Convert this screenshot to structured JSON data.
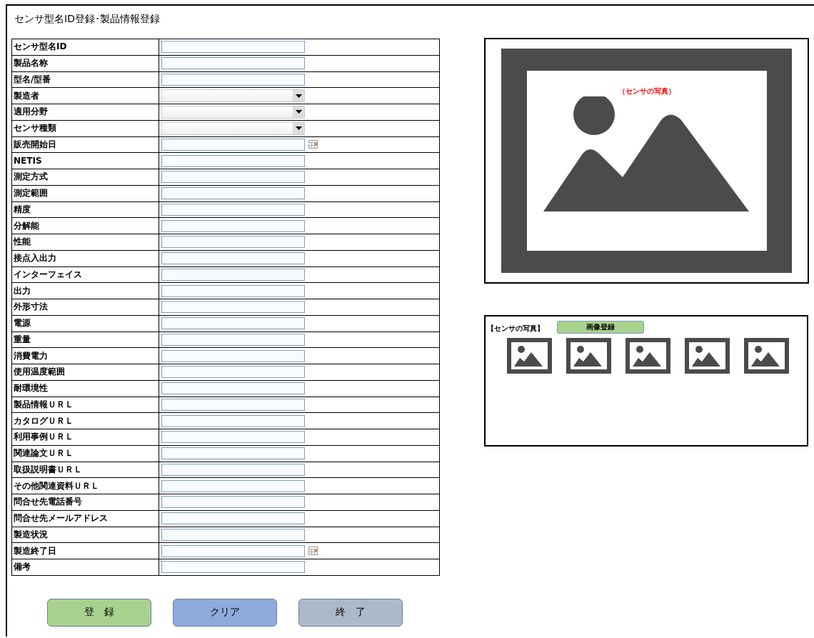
{
  "window": {
    "title": "センサ型名ID登録･製品情報登録"
  },
  "fields": [
    {
      "label": "センサ型名ID",
      "kind": "text"
    },
    {
      "label": "製品名称",
      "kind": "text"
    },
    {
      "label": "型名/型番",
      "kind": "text"
    },
    {
      "label": "製造者",
      "kind": "select"
    },
    {
      "label": "適用分野",
      "kind": "select"
    },
    {
      "label": "センサ種類",
      "kind": "select"
    },
    {
      "label": "販売開始日",
      "kind": "date"
    },
    {
      "label": "NETIS",
      "kind": "text"
    },
    {
      "label": "測定方式",
      "kind": "text"
    },
    {
      "label": "測定範囲",
      "kind": "text"
    },
    {
      "label": "精度",
      "kind": "text"
    },
    {
      "label": "分解能",
      "kind": "text"
    },
    {
      "label": "性能",
      "kind": "text"
    },
    {
      "label": "接点入出力",
      "kind": "text"
    },
    {
      "label": "インターフェイス",
      "kind": "text"
    },
    {
      "label": "出力",
      "kind": "text"
    },
    {
      "label": "外形寸法",
      "kind": "text"
    },
    {
      "label": "電源",
      "kind": "text"
    },
    {
      "label": "重量",
      "kind": "text"
    },
    {
      "label": "消費電力",
      "kind": "text"
    },
    {
      "label": "使用温度範囲",
      "kind": "text"
    },
    {
      "label": "耐環境性",
      "kind": "text"
    },
    {
      "label": "製品情報ＵＲＬ",
      "kind": "text"
    },
    {
      "label": "カタログＵＲＬ",
      "kind": "text"
    },
    {
      "label": "利用事例ＵＲＬ",
      "kind": "text"
    },
    {
      "label": "関連論文ＵＲＬ",
      "kind": "text"
    },
    {
      "label": "取扱説明書ＵＲＬ",
      "kind": "text"
    },
    {
      "label": "その他関連資料ＵＲＬ",
      "kind": "text"
    },
    {
      "label": "問合せ先電話番号",
      "kind": "text"
    },
    {
      "label": "問合せ先メールアドレス",
      "kind": "text"
    },
    {
      "label": "製造状況",
      "kind": "text"
    },
    {
      "label": "製造終了日",
      "kind": "date"
    },
    {
      "label": "備考",
      "kind": "text"
    }
  ],
  "photo": {
    "caption": "（センサの写真）"
  },
  "gallery": {
    "label": "【センサの写真】",
    "button": "画像登録",
    "thumbnails": [
      {
        "kind": "image"
      },
      {
        "kind": "image"
      },
      {
        "kind": "image"
      },
      {
        "kind": "image"
      },
      {
        "kind": "image"
      }
    ]
  },
  "buttons": [
    {
      "label": "登　録",
      "kind": "register"
    },
    {
      "label": "クリア",
      "kind": "clear"
    },
    {
      "label": "終　了",
      "kind": "exit"
    }
  ]
}
